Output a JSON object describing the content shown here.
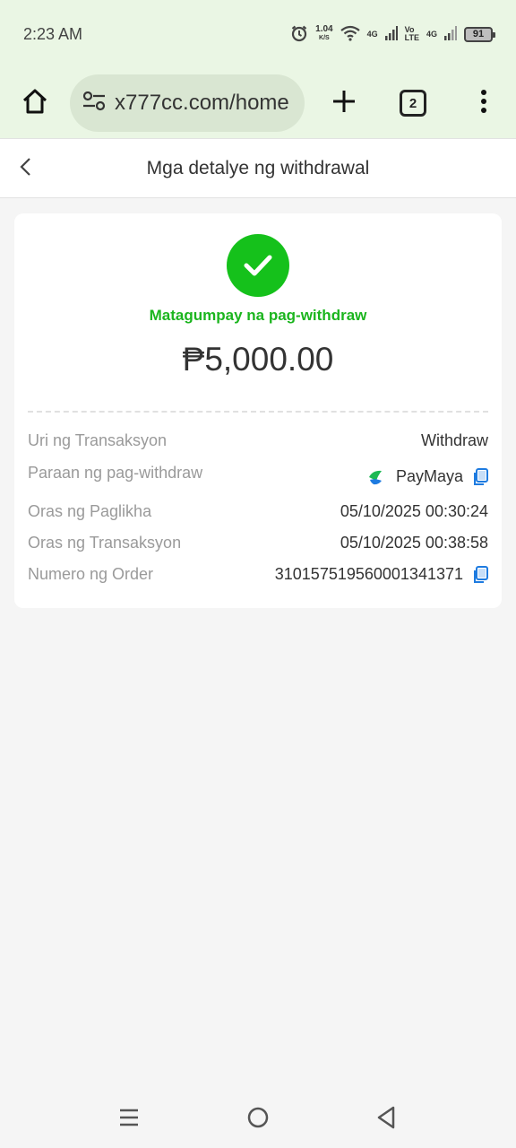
{
  "status_bar": {
    "time": "2:23 AM",
    "net_speed": "1.04",
    "net_unit": "K/S",
    "sig1": "4G",
    "volte_top": "Vo",
    "volte_bottom": "LTE",
    "sig2": "4G",
    "battery": "91"
  },
  "browser": {
    "url": "x777cc.com/home",
    "tab_count": "2",
    "icons": [
      "home-icon",
      "site-settings-icon",
      "plus-icon",
      "tabs-icon",
      "more-vert-icon"
    ]
  },
  "header": {
    "title": "Mga detalye ng withdrawal",
    "back_icon": "chevron-left-icon"
  },
  "card": {
    "status_text": "Matagumpay na pag-withdraw",
    "amount": "₱5,000.00",
    "success_color": "#15c11b",
    "rows": [
      {
        "label": "Uri ng Transaksyon",
        "value": "Withdraw"
      },
      {
        "label": "Paraan ng pag-withdraw",
        "value": "PayMaya"
      },
      {
        "label": "Oras ng Paglikha",
        "value": "05/10/2025 00:30:24"
      },
      {
        "label": "Oras ng Transaksyon",
        "value": "05/10/2025 00:38:58"
      },
      {
        "label": "Numero ng Order",
        "value": "310157519560001341371"
      }
    ]
  },
  "nav_bar": {
    "icons": [
      "recent-apps-icon",
      "home-circle-icon",
      "back-triangle-icon"
    ]
  }
}
